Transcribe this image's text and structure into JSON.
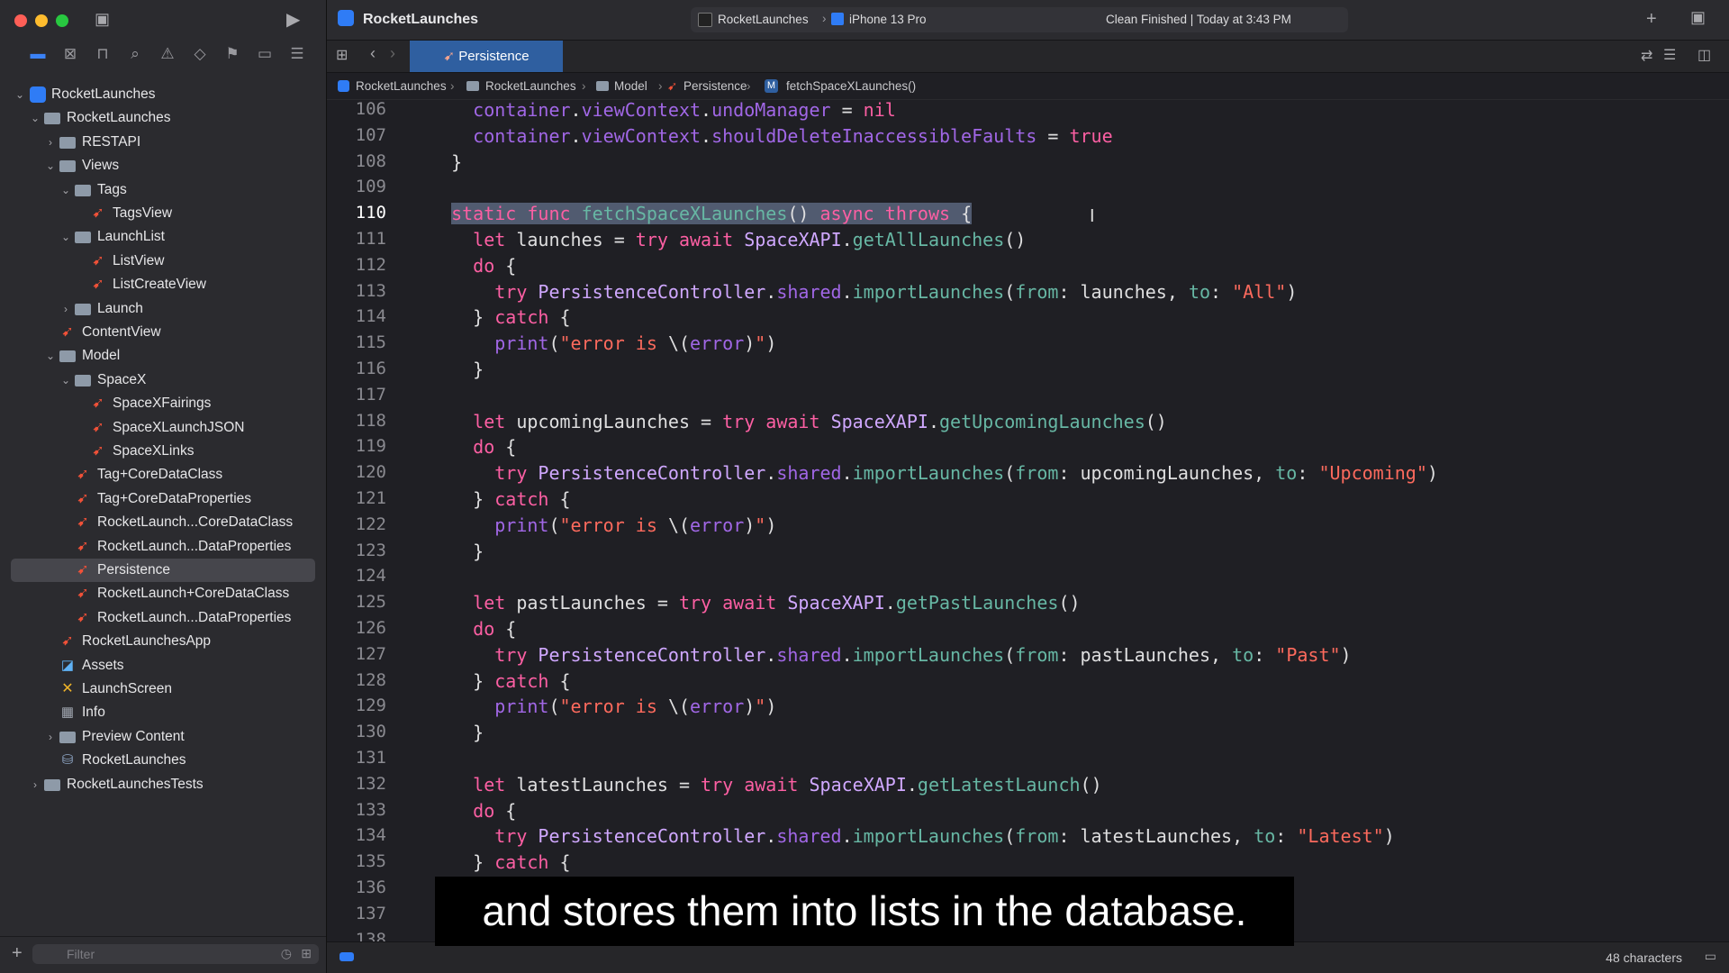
{
  "window": {
    "project": "RocketLaunches",
    "scheme_target": "RocketLaunches",
    "device": "iPhone 13 Pro",
    "status": "Clean Finished | Today at 3:43 PM"
  },
  "navigator": {
    "filter_placeholder": "Filter",
    "items": [
      {
        "label": "RocketLaunches"
      },
      {
        "label": "RocketLaunches"
      },
      {
        "label": "RESTAPI"
      },
      {
        "label": "Views"
      },
      {
        "label": "Tags"
      },
      {
        "label": "TagsView"
      },
      {
        "label": "LaunchList"
      },
      {
        "label": "ListView"
      },
      {
        "label": "ListCreateView"
      },
      {
        "label": "Launch"
      },
      {
        "label": "ContentView"
      },
      {
        "label": "Model"
      },
      {
        "label": "SpaceX"
      },
      {
        "label": "SpaceXFairings"
      },
      {
        "label": "SpaceXLaunchJSON"
      },
      {
        "label": "SpaceXLinks"
      },
      {
        "label": "Tag+CoreDataClass"
      },
      {
        "label": "Tag+CoreDataProperties"
      },
      {
        "label": "RocketLaunch...CoreDataClass"
      },
      {
        "label": "RocketLaunch...DataProperties"
      },
      {
        "label": "Persistence"
      },
      {
        "label": "RocketLaunch+CoreDataClass"
      },
      {
        "label": "RocketLaunch...DataProperties"
      },
      {
        "label": "RocketLaunchesApp"
      },
      {
        "label": "Assets"
      },
      {
        "label": "LaunchScreen"
      },
      {
        "label": "Info"
      },
      {
        "label": "Preview Content"
      },
      {
        "label": "RocketLaunches"
      },
      {
        "label": "RocketLaunchesTests"
      }
    ]
  },
  "editor": {
    "tab": "Persistence",
    "breadcrumb": [
      "RocketLaunches",
      "RocketLaunches",
      "Model",
      "Persistence",
      "fetchSpaceXLaunches()"
    ],
    "line_numbers": [
      "106",
      "107",
      "108",
      "109",
      "110",
      "111",
      "112",
      "113",
      "114",
      "115",
      "116",
      "117",
      "118",
      "119",
      "120",
      "121",
      "122",
      "123",
      "124",
      "125",
      "126",
      "127",
      "128",
      "129",
      "130",
      "131",
      "132",
      "133",
      "134",
      "135",
      "136",
      "137",
      "138"
    ],
    "status_right": "48 characters"
  },
  "caption": "and stores them into lists in the database."
}
